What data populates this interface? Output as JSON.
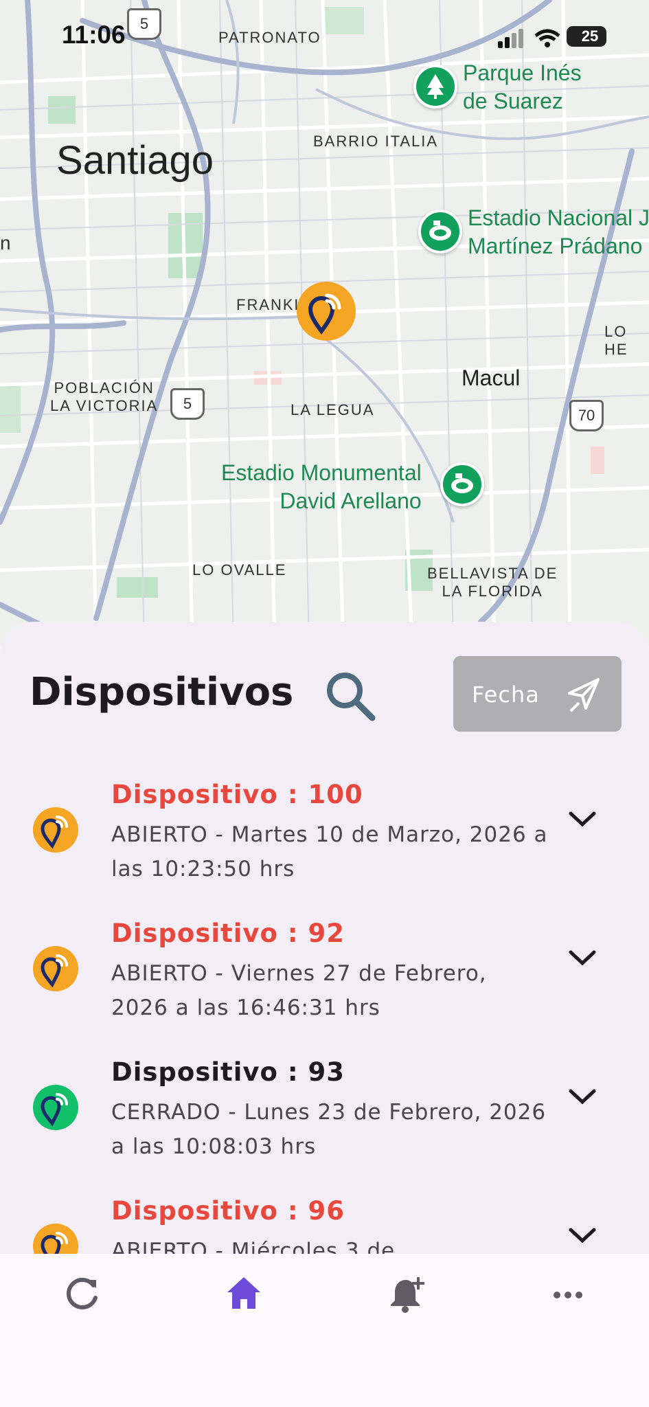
{
  "status_bar": {
    "time": "11:06",
    "battery": "25"
  },
  "map": {
    "city_label": "Santiago",
    "labels": {
      "patronato": "PATRONATO",
      "barrio_italia": "BARRIO ITALIA",
      "franklin": "FRANKL",
      "poblacion_1": "POBLACIÓN",
      "poblacion_2": "LA VICTORIA",
      "la_legua": "LA LEGUA",
      "macul": "Macul",
      "lo_ovalle": "LO OVALLE",
      "bellavista_1": "BELLAVISTA DE",
      "bellavista_2": "LA FLORIDA",
      "lo_he": "LO HE",
      "edge_n": "n"
    },
    "pois": {
      "parque_1": "Parque Inés",
      "parque_2": "de Suarez",
      "estadio_nacional_1": "Estadio Nacional J",
      "estadio_nacional_2": "Martínez Prádano",
      "monumental_1": "Estadio Monumental",
      "monumental_2": "David Arellano"
    },
    "route_shields": {
      "top": "5",
      "mid": "5",
      "right": "70"
    }
  },
  "panel": {
    "title": "Dispositivos",
    "date_button": "Fecha"
  },
  "devices": [
    {
      "name": "Dispositivo : 100",
      "desc": "ABIERTO - Martes 10 de Marzo, 2026 a las 10:23:50 hrs",
      "status": "open",
      "name_color": "#E8473D",
      "avatar_color": "#F5A524"
    },
    {
      "name": "Dispositivo : 92",
      "desc": "ABIERTO - Viernes 27 de Febrero, 2026 a las 16:46:31 hrs",
      "status": "open",
      "name_color": "#E8473D",
      "avatar_color": "#F5A524"
    },
    {
      "name": "Dispositivo : 93",
      "desc": "CERRADO - Lunes 23 de Febrero, 2026 a las 10:08:03 hrs",
      "status": "closed",
      "name_color": "#1D1B20",
      "avatar_color": "#12C06A"
    },
    {
      "name": "Dispositivo : 96",
      "desc": "ABIERTO - Miércoles 3 de",
      "status": "open",
      "name_color": "#E8473D",
      "avatar_color": "#F5A524"
    }
  ],
  "navbar": [
    {
      "icon": "refresh-icon",
      "active": false
    },
    {
      "icon": "home-icon",
      "active": true
    },
    {
      "icon": "bell-plus-icon",
      "active": false
    },
    {
      "icon": "more-icon",
      "active": false
    }
  ],
  "colors": {
    "accent": "#6E4BD8",
    "open": "#E8473D",
    "pin_orange": "#F5A524",
    "pin_green": "#12C06A",
    "park_text": "#1E8A52"
  }
}
